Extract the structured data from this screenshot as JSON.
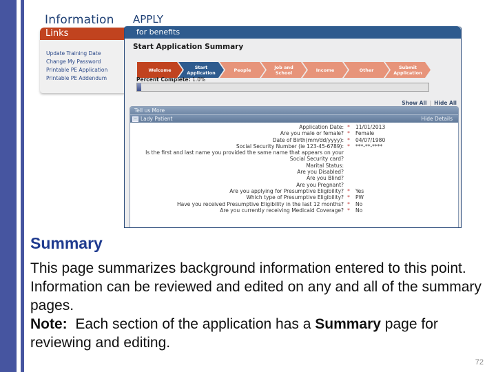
{
  "info_panel": {
    "title": "Information",
    "links_header": "Links",
    "links": [
      "Update Training Date",
      "Change My Password",
      "Printable PE Application",
      "Printable PE Addendum"
    ]
  },
  "app": {
    "title": "APPLY",
    "header": "for benefits",
    "subtitle": "Start Application Summary",
    "steps": [
      {
        "label": "Welcome",
        "state": "done"
      },
      {
        "label": "Start Application",
        "state": "active"
      },
      {
        "label": "People",
        "state": "pending"
      },
      {
        "label": "Job and School",
        "state": "pending"
      },
      {
        "label": "Income",
        "state": "pending"
      },
      {
        "label": "Other",
        "state": "pending"
      },
      {
        "label": "Submit Application",
        "state": "pending"
      }
    ],
    "percent_label": "Percent Complete:",
    "percent_value": "1.0%",
    "percent_fraction": 0.01,
    "show_all": "Show All",
    "separator": "|",
    "hide_all": "Hide All",
    "section_title": "Tell us More",
    "person_name": "Lady Patient",
    "toggle_symbol": "−",
    "hide_details": "Hide Details",
    "rows": [
      {
        "question": "Application Date:",
        "required": "*",
        "answer": "11/01/2013"
      },
      {
        "question": "Are you male or female?",
        "required": "*",
        "answer": "Female"
      },
      {
        "question": "Date of Birth(mm/dd/yyyy):",
        "required": "*",
        "answer": "04/07/1980"
      },
      {
        "question": "Social Security Number (ie 123-45-6789):",
        "required": "*",
        "answer": "***-**-****"
      },
      {
        "question": "Is the first and last name you provided the same name that appears on your Social Security card?",
        "required": "",
        "answer": ""
      },
      {
        "question": "Marital Status:",
        "required": "",
        "answer": ""
      },
      {
        "question": "Are you Disabled?",
        "required": "",
        "answer": ""
      },
      {
        "question": "Are you Blind?",
        "required": "",
        "answer": ""
      },
      {
        "question": "Are you Pregnant?",
        "required": "",
        "answer": ""
      },
      {
        "question": "Are you applying for Presumptive Eligibility?",
        "required": "*",
        "answer": "Yes"
      },
      {
        "question": "Which type of Presumptive Eligibility?",
        "required": "*",
        "answer": "PW"
      },
      {
        "question": "Have you received Presumptive Eligibility in the last 12 months?",
        "required": "*",
        "answer": "No"
      },
      {
        "question": "Are you currently receiving Medicaid Coverage?",
        "required": "*",
        "answer": "No"
      }
    ]
  },
  "slide": {
    "heading": "Summary",
    "body_line1": "This page summarizes background information entered to this point. Information can be reviewed  and edited on any and all of the summary pages.",
    "note_label": "Note:",
    "note_text_before": "  Each section of the application has a ",
    "note_bold": "Summary",
    "note_text_after": " page for reviewing and editing.",
    "page_number": "72"
  },
  "colors": {
    "slide_bar": "#4655a0",
    "links_header": "#c1431f",
    "app_header": "#2e5b8e",
    "step_done": "#c1431f",
    "step_active": "#2e5b8e",
    "step_pending": "#e7947a",
    "heading_blue": "#1f3b8f"
  }
}
